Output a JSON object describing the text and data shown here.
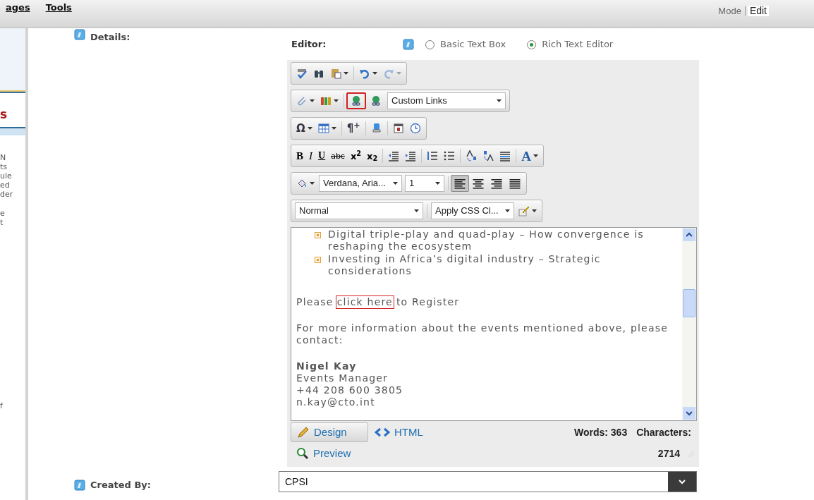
{
  "menu": [
    {
      "label": "ages"
    },
    {
      "label": "Tools"
    }
  ],
  "mode": {
    "label": "Mode",
    "value": "Edit"
  },
  "sidebar": {
    "heading": "s",
    "fragments": [
      "N",
      "ts",
      "ule",
      "ed",
      "der",
      "e",
      "t"
    ],
    "footer_fragment": "f"
  },
  "details": {
    "label": "Details:"
  },
  "editor_mode": {
    "label": "Editor:",
    "options": [
      {
        "label": "Basic Text Box",
        "selected": false
      },
      {
        "label": "Rich Text Editor",
        "selected": true
      }
    ]
  },
  "toolbar": [
    {
      "groups": [
        [
          {
            "kind": "spell",
            "dropdown": false,
            "disabled": false
          },
          {
            "kind": "find",
            "dropdown": false,
            "disabled": false
          },
          {
            "kind": "paste",
            "dropdown": true,
            "disabled": false
          }
        ],
        [
          {
            "kind": "undo",
            "dropdown": true,
            "disabled": false
          },
          {
            "kind": "redo",
            "dropdown": true,
            "disabled": true
          }
        ]
      ]
    },
    {
      "groups": [
        [
          {
            "kind": "attach",
            "dropdown": true,
            "disabled": false
          },
          {
            "kind": "media",
            "dropdown": true,
            "disabled": false
          }
        ],
        [
          {
            "kind": "link",
            "dropdown": false,
            "disabled": false,
            "highlighted": true
          },
          {
            "kind": "link",
            "dropdown": false,
            "disabled": false,
            "highlighted": false
          },
          {
            "kind": "select",
            "value": "Custom Links"
          }
        ]
      ]
    },
    {
      "groups": [
        [
          {
            "kind": "glyph",
            "text": "Ω",
            "dropdown": true,
            "disabled": false
          },
          {
            "kind": "table",
            "dropdown": true,
            "disabled": false
          }
        ],
        [
          {
            "kind": "glyph",
            "text": "¶$^{+}$",
            "dropdown": false,
            "disabled": false
          }
        ],
        [
          {
            "kind": "module",
            "dropdown": false,
            "disabled": false
          }
        ],
        [
          {
            "kind": "calendar",
            "dropdown": false,
            "disabled": false
          },
          {
            "kind": "clock",
            "dropdown": false,
            "disabled": false
          }
        ]
      ]
    },
    {
      "groups": [
        [
          {
            "kind": "glyph",
            "text": "B",
            "dropdown": false,
            "disabled": false
          },
          {
            "kind": "glyph",
            "text": "I",
            "dropdown": false,
            "disabled": false
          },
          {
            "kind": "glyph",
            "text": "U",
            "dropdown": false,
            "disabled": false
          },
          {
            "kind": "glyph",
            "text": "abc",
            "dropdown": false,
            "disabled": false
          },
          {
            "kind": "glyph",
            "text": "x$^{2}$",
            "dropdown": false,
            "disabled": false
          },
          {
            "kind": "glyph",
            "text": "x$_{2}$",
            "dropdown": false,
            "disabled": false
          }
        ],
        [
          {
            "kind": "outdent",
            "dropdown": false,
            "disabled": false
          },
          {
            "kind": "indent",
            "dropdown": false,
            "disabled": false
          }
        ],
        [
          {
            "kind": "numbered",
            "dropdown": false,
            "disabled": false
          },
          {
            "kind": "bulleted",
            "dropdown": false,
            "disabled": false
          }
        ],
        [
          {
            "kind": "grow",
            "dropdown": false,
            "disabled": false
          },
          {
            "kind": "shrink",
            "dropdown": false,
            "disabled": false
          },
          {
            "kind": "lines",
            "dropdown": false,
            "disabled": false
          }
        ],
        [
          {
            "kind": "glyph",
            "text": "A",
            "dropdown": true,
            "disabled": false
          }
        ]
      ]
    },
    {
      "groups": [
        [
          {
            "kind": "bucket",
            "dropdown": true,
            "disabled": false
          },
          {
            "kind": "select",
            "value": "Verdana, Aria..."
          },
          {
            "kind": "select",
            "value": "1"
          }
        ],
        [
          {
            "kind": "align",
            "selected": true,
            "dropdown": false,
            "disabled": false
          },
          {
            "kind": "align",
            "selected": false,
            "dropdown": false,
            "disabled": false
          },
          {
            "kind": "align",
            "selected": false,
            "dropdown": false,
            "disabled": false
          },
          {
            "kind": "align",
            "selected": false,
            "dropdown": false,
            "disabled": false
          }
        ]
      ]
    },
    {
      "groups": [
        [
          {
            "kind": "select",
            "value": "Normal"
          }
        ],
        [
          {
            "kind": "select",
            "value": "Apply CSS Cl..."
          },
          {
            "kind": "brush",
            "dropdown": true,
            "disabled": false
          }
        ]
      ]
    }
  ],
  "content": [
    {
      "kind": "bullet",
      "text": "Digital triple-play and quad-play – How convergence is reshaping the ecosystem"
    },
    {
      "kind": "bullet",
      "text": "Investing in Africa’s digital industry – Strategic considerations"
    },
    {
      "kind": "gap"
    },
    {
      "kind": "link_line",
      "before": "Please",
      "link": "click here",
      "after": "to Register",
      "highlighted": true
    },
    {
      "kind": "paragraph",
      "text": "For more information about the events mentioned above, please contact:"
    },
    {
      "kind": "contact",
      "lines": [
        "Nigel Kay",
        "Events Manager",
        "+44 208 600 3805",
        "n.kay@cto.int"
      ]
    }
  ],
  "footer": {
    "modes": [
      {
        "kind": "design",
        "label": "Design",
        "selected": true
      },
      {
        "kind": "html",
        "label": "HTML",
        "selected": false
      }
    ],
    "preview": "Preview",
    "words": "Words: 363",
    "characters": "Characters:",
    "character_count": "2714"
  },
  "created_by": {
    "label": "Created By:",
    "value": "CPSI"
  }
}
